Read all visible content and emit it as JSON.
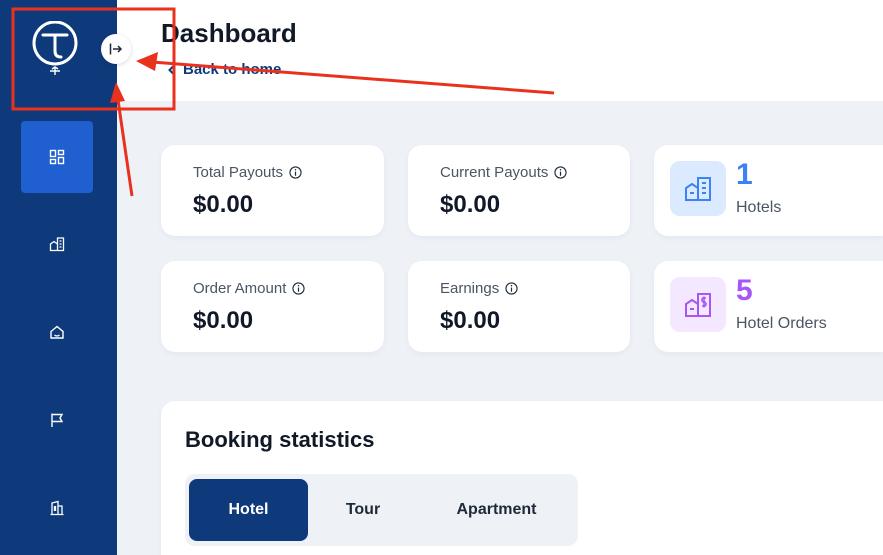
{
  "header": {
    "title": "Dashboard",
    "back_link": "Back to home"
  },
  "sidebar": {
    "items": [
      {
        "icon": "dashboard-icon",
        "active": true
      },
      {
        "icon": "hotel-icon",
        "active": false
      },
      {
        "icon": "home-icon",
        "active": false
      },
      {
        "icon": "flag-icon",
        "active": false
      },
      {
        "icon": "building-icon",
        "active": false
      }
    ]
  },
  "stats": [
    {
      "label": "Total Payouts",
      "value": "$0.00"
    },
    {
      "label": "Current Payouts",
      "value": "$0.00"
    },
    {
      "label": "Order Amount",
      "value": "$0.00"
    },
    {
      "label": "Earnings",
      "value": "$0.00"
    }
  ],
  "counts": [
    {
      "value": "1",
      "label": "Hotels",
      "color": "#3b82f6",
      "tile_bg": "#dbeafe"
    },
    {
      "value": "5",
      "label": "Hotel Orders",
      "color": "#a855f7",
      "tile_bg": "#f3e8ff"
    }
  ],
  "booking": {
    "title": "Booking statistics",
    "tabs": [
      "Hotel",
      "Tour",
      "Apartment"
    ],
    "active_tab": "Hotel"
  },
  "colors": {
    "sidebar_bg": "#0e3a7b",
    "accent": "#1f5fcf",
    "annotation": "#e8321e"
  }
}
